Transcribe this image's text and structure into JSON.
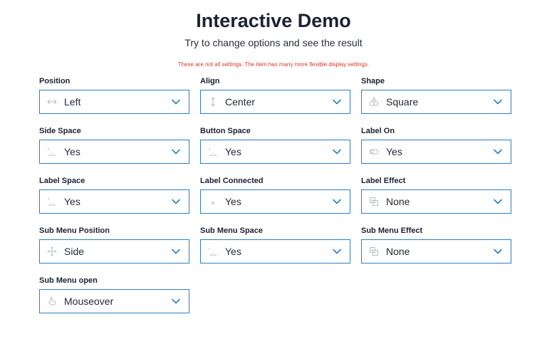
{
  "header": {
    "title": "Interactive Demo",
    "subtitle": "Try to change options and see the result",
    "note": "These are not all settings. The item has many more flexible display settings."
  },
  "colors": {
    "border": "#2a7fc7",
    "chevron": "#2a7fc7",
    "note": "#d23a2c",
    "icon": "#b8bec8"
  },
  "fields": [
    {
      "label": "Position",
      "value": "Left",
      "icon": "horizontal-arrows-icon"
    },
    {
      "label": "Align",
      "value": "Center",
      "icon": "vertical-arrows-icon"
    },
    {
      "label": "Shape",
      "value": "Square",
      "icon": "shapes-icon"
    },
    {
      "label": "Side Space",
      "value": "Yes",
      "icon": "spacing-icon"
    },
    {
      "label": "Button Space",
      "value": "Yes",
      "icon": "spacing-icon"
    },
    {
      "label": "Label On",
      "value": "Yes",
      "icon": "toggle-icon"
    },
    {
      "label": "Label Space",
      "value": "Yes",
      "icon": "spacing-icon"
    },
    {
      "label": "Label Connected",
      "value": "Yes",
      "icon": "dot-icon"
    },
    {
      "label": "Label Effect",
      "value": "None",
      "icon": "effect-icon"
    },
    {
      "label": "Sub Menu Position",
      "value": "Side",
      "icon": "move-icon"
    },
    {
      "label": "Sub Menu Space",
      "value": "Yes",
      "icon": "spacing-icon"
    },
    {
      "label": "Sub Menu Effect",
      "value": "None",
      "icon": "effect-icon"
    },
    {
      "label": "Sub Menu open",
      "value": "Mouseover",
      "icon": "pointer-hand-icon"
    }
  ]
}
